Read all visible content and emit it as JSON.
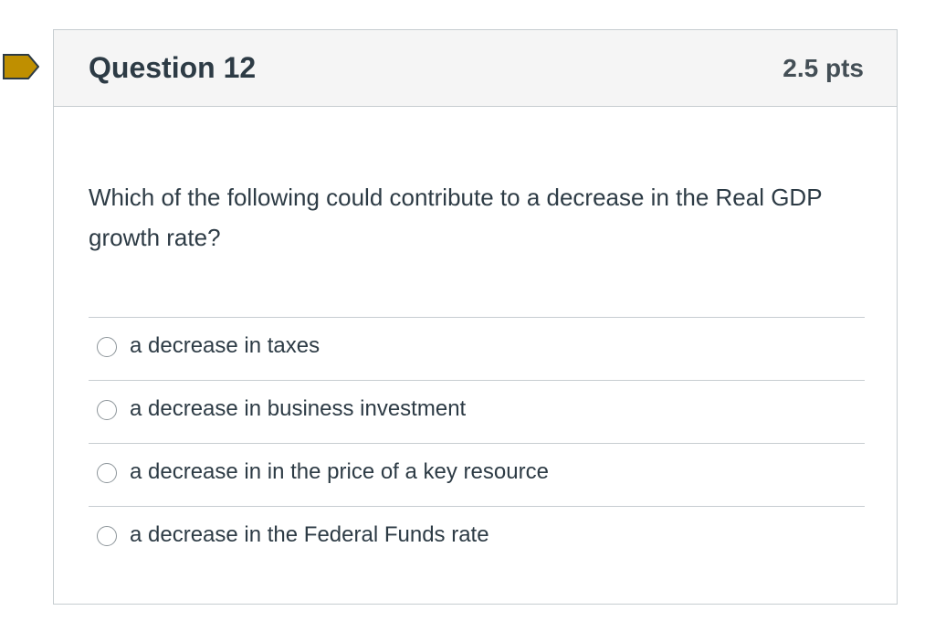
{
  "question": {
    "title": "Question 12",
    "points": "2.5 pts",
    "text": "Which of the following could contribute to a decrease in the Real GDP growth rate?",
    "flag_color": "#bf8f00"
  },
  "answers": [
    {
      "label": "a decrease in taxes",
      "selected": false
    },
    {
      "label": "a decrease in business investment",
      "selected": false
    },
    {
      "label": "a decrease in in the price of a key resource",
      "selected": false
    },
    {
      "label": "a decrease in the Federal Funds rate",
      "selected": false
    }
  ]
}
